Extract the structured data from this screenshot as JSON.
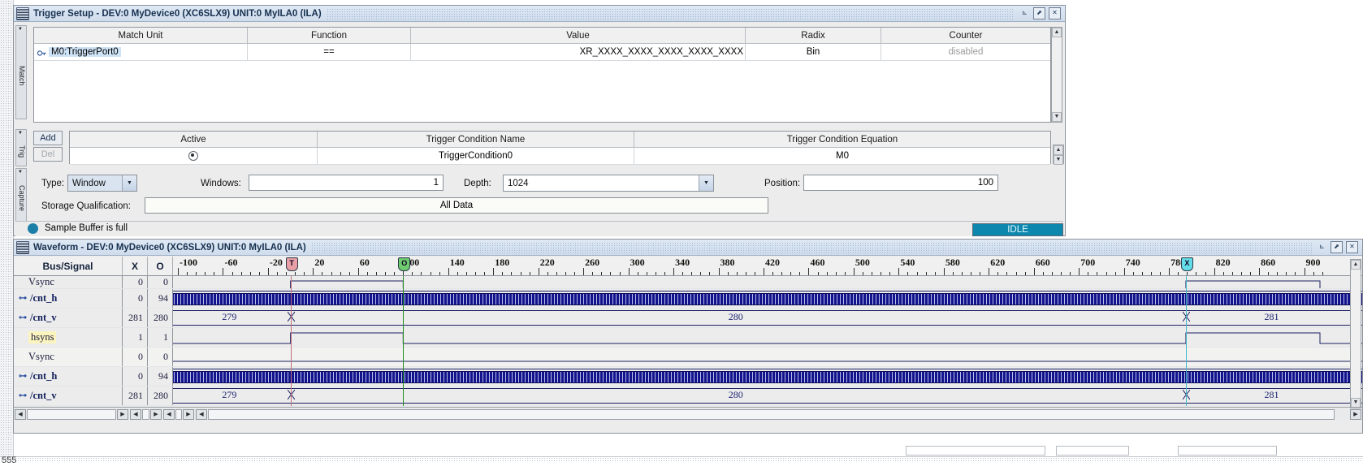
{
  "trigger_setup": {
    "title": "Trigger Setup - DEV:0 MyDevice0 (XC6SLX9) UNIT:0 MyILA0 (ILA)",
    "side_tabs": [
      "Match",
      "Trig",
      "Capture"
    ],
    "match_table": {
      "headers": [
        "Match Unit",
        "Function",
        "Value",
        "Radix",
        "Counter"
      ],
      "rows": [
        {
          "match_unit": "M0:TriggerPort0",
          "function": "==",
          "value": "XR_XXXX_XXXX_XXXX_XXXX_XXXX",
          "radix": "Bin",
          "counter": "disabled"
        }
      ]
    },
    "trig_table": {
      "add_label": "Add",
      "del_label": "Del",
      "headers": [
        "Active",
        "Trigger Condition Name",
        "Trigger Condition Equation"
      ],
      "rows": [
        {
          "active": "selected",
          "name": "TriggerCondition0",
          "equation": "M0"
        }
      ]
    },
    "capture": {
      "type_label": "Type:",
      "type_value": "Window",
      "windows_label": "Windows:",
      "windows_value": "1",
      "depth_label": "Depth:",
      "depth_value": "1024",
      "position_label": "Position:",
      "position_value": "100",
      "storage_label": "Storage Qualification:",
      "storage_value": "All Data"
    },
    "status": {
      "text": "Sample Buffer is full",
      "badge": "IDLE",
      "dot_color": "#1b7fa8",
      "badge_color": "#0d87ad"
    }
  },
  "waveform": {
    "title": "Waveform - DEV:0 MyDevice0 (XC6SLX9) UNIT:0 MyILA0 (ILA)",
    "headers": [
      "Bus/Signal",
      "X",
      "O"
    ],
    "ruler": {
      "labels": [
        "-100",
        "-60",
        "-20",
        "20",
        "60",
        "100",
        "140",
        "180",
        "220",
        "260",
        "300",
        "340",
        "380",
        "420",
        "460",
        "500",
        "540",
        "580",
        "620",
        "660",
        "700",
        "740",
        "780",
        "820",
        "860",
        "900"
      ]
    },
    "cursors": {
      "trigger": {
        "glyph": "T",
        "color": "#e8a0a6",
        "line": "#c07078"
      },
      "origin": {
        "glyph": "O",
        "color": "#6ecb6e",
        "line": "#1f8a1f"
      },
      "xmark": {
        "glyph": "X",
        "color": "#63dde8",
        "line": "#3fb8c8"
      }
    },
    "signals": [
      {
        "name": "Vsync",
        "kind": "clipped",
        "x": "0",
        "o": "0",
        "type": "wire"
      },
      {
        "name": "/cnt_h",
        "kind": "bus",
        "x": "0",
        "o": "94",
        "type": "bus"
      },
      {
        "name": "/cnt_v",
        "kind": "bus",
        "x": "281",
        "o": "280",
        "type": "busval",
        "segments": [
          "279",
          "280",
          "281"
        ]
      },
      {
        "name": "hsyns",
        "kind": "wire",
        "x": "1",
        "o": "1",
        "type": "wire",
        "highlight": true
      },
      {
        "name": "Vsync",
        "kind": "wire",
        "x": "0",
        "o": "0",
        "type": "flat"
      },
      {
        "name": "/cnt_h",
        "kind": "bus",
        "x": "0",
        "o": "94",
        "type": "bus"
      },
      {
        "name": "/cnt_v",
        "kind": "bus",
        "x": "281",
        "o": "280",
        "type": "busval",
        "segments": [
          "279",
          "280",
          "281"
        ]
      }
    ]
  },
  "taskbar": {
    "text": "555"
  }
}
